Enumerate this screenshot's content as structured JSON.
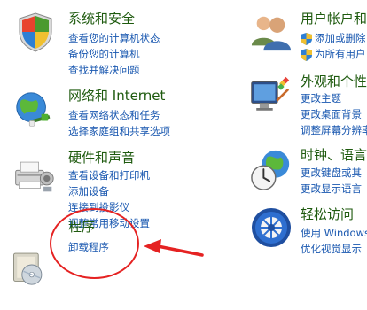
{
  "left_column": {
    "system_security": {
      "title": "系统和安全",
      "links": [
        "查看您的计算机状态",
        "备份您的计算机",
        "查找并解决问题"
      ]
    },
    "network_internet": {
      "title": "网络和 Internet",
      "links": [
        "查看网络状态和任务",
        "选择家庭组和共享选项"
      ]
    },
    "hardware_sound": {
      "title": "硬件和声音",
      "links": [
        "查看设备和打印机",
        "添加设备",
        "连接到投影仪",
        "调整常用移动设置"
      ]
    },
    "programs": {
      "title": "程序",
      "links": [
        "卸载程序"
      ]
    }
  },
  "right_column": {
    "user_accounts": {
      "title": "用户帐户和",
      "links": [
        "添加或删除",
        "为所有用户"
      ]
    },
    "appearance": {
      "title": "外观和个性",
      "links": [
        "更改主题",
        "更改桌面背景",
        "调整屏幕分辨率"
      ]
    },
    "clock_language": {
      "title": "时钟、语言",
      "links": [
        "更改键盘或其",
        "更改显示语言"
      ]
    },
    "ease_of_access": {
      "title": "轻松访问",
      "links": [
        "使用 Windows",
        "优化视觉显示"
      ]
    }
  },
  "colors": {
    "title": "#1e5a0e",
    "link": "#1a58b0",
    "annotation": "#e52222"
  }
}
